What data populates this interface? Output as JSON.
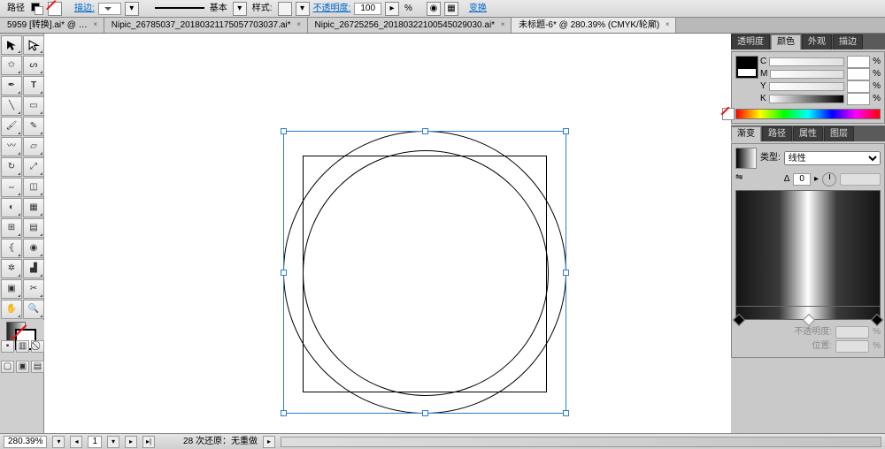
{
  "topbar": {
    "selection_label": "路径",
    "stroke_label": "描边:",
    "stroke_value": "",
    "line_preset": "基本",
    "style_label": "样式:",
    "opacity_link": "不透明度:",
    "opacity_value": "100",
    "transform_link": "变换"
  },
  "tabs": [
    {
      "label": "5959  [转换].ai* @ …"
    },
    {
      "label": "Nipic_26785037_20180321175057703037.ai*"
    },
    {
      "label": "Nipic_26725256_20180322100545029030.ai*"
    },
    {
      "label": "未标题-6* @ 280.39% (CMYK/轮廓)",
      "active": true
    }
  ],
  "panels": {
    "group1": {
      "tabs": [
        "透明度",
        "颜色",
        "外观",
        "描边"
      ],
      "active": 1
    },
    "color": {
      "channels": [
        "C",
        "M",
        "Y",
        "K"
      ],
      "pct": "%"
    },
    "group2": {
      "tabs": [
        "渐变",
        "路径",
        "属性",
        "图层"
      ],
      "active": 0
    },
    "gradient": {
      "type_label": "类型:",
      "type_value": "线性",
      "angle_label": "Δ",
      "angle_value": "0",
      "opacity_label": "不透明度:",
      "position_label": "位置:",
      "pct": "%"
    }
  },
  "status": {
    "zoom": "280.39%",
    "page": "1",
    "undo": "28 次还原：无重做"
  }
}
